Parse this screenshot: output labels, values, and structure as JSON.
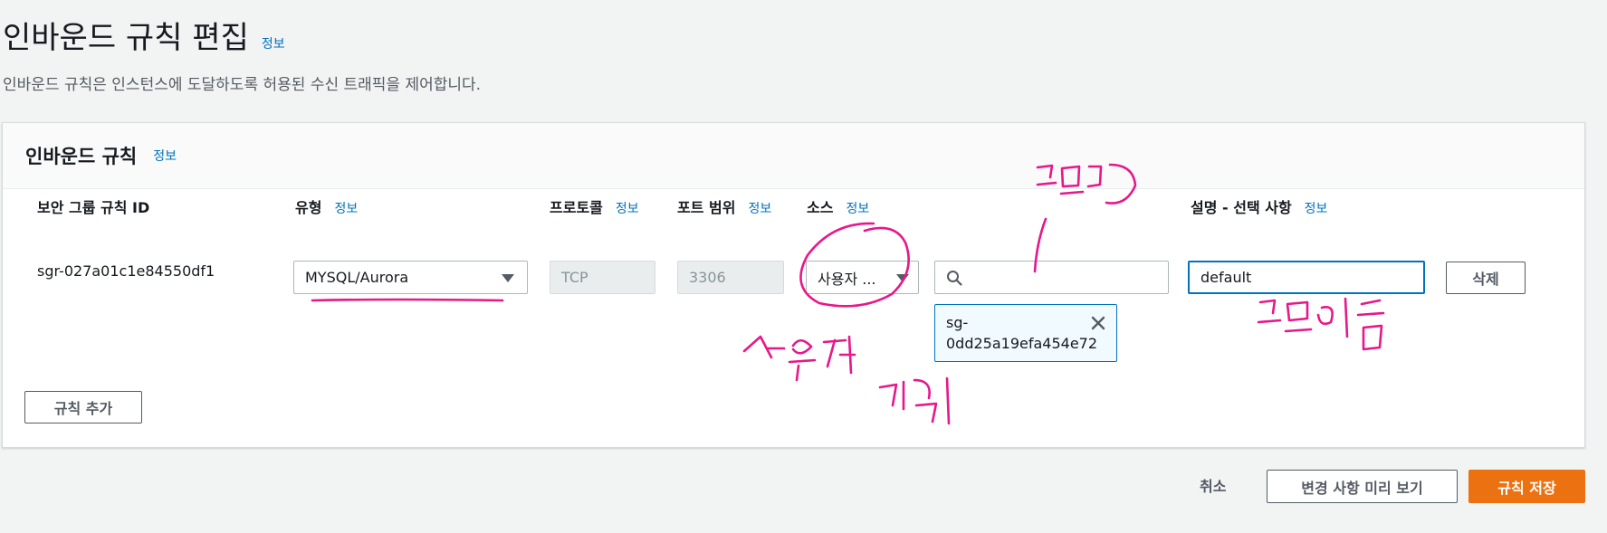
{
  "header": {
    "title": "인바운드 규칙 편집",
    "info": "정보",
    "description": "인바운드 규칙은 인스턴스에 도달하도록 허용된 수신 트래픽을 제어합니다."
  },
  "panel": {
    "title": "인바운드 규칙",
    "info": "정보",
    "columns": {
      "rule_id": "보안 그룹 규칙 ID",
      "type": "유형",
      "type_info": "정보",
      "protocol": "프로토콜",
      "protocol_info": "정보",
      "port_range": "포트 범위",
      "port_info": "정보",
      "source": "소스",
      "source_info": "정보",
      "description": "설명 - 선택 사항",
      "description_info": "정보"
    },
    "row": {
      "rule_id": "sgr-027a01c1e84550df1",
      "type": "MYSQL/Aurora",
      "protocol": "TCP",
      "port_range": "3306",
      "source": "사용자 ...",
      "source_search": "",
      "source_token": "sg-0dd25a19efa454e72",
      "description": "default",
      "delete_label": "삭제"
    },
    "add_rule_label": "규칙 추가"
  },
  "footer": {
    "cancel_label": "취소",
    "preview_label": "변경 사항 미리 보기",
    "save_label": "규칙 저장"
  },
  "handwritten_notes": [
    "그룹ID",
    "사용자 지정",
    "그룹이름"
  ],
  "colors": {
    "accent": "#0073bb",
    "primary_button": "#ec7211",
    "annotation_ink": "#e8178a"
  },
  "icons": {
    "dropdown": "caret-down-icon",
    "search": "search-icon",
    "remove_token": "close-icon"
  }
}
